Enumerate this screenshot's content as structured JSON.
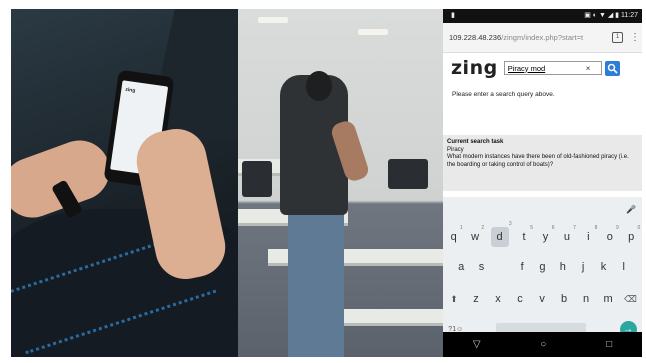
{
  "status_bar": {
    "time": "11:27",
    "icons": "▣ ◐ ▼ ◢ ▮"
  },
  "browser": {
    "url_host": "109.228.48.236",
    "url_path": "/zingm/index.php?start=t",
    "tabs_count": "1",
    "menu_glyph": "⋮"
  },
  "app": {
    "logo": "zing",
    "search_value": "Piracy mod",
    "clear_glyph": "×"
  },
  "prompt_text": "Please enter a search query above.",
  "task": {
    "title": "Current search task",
    "topic": "Piracy",
    "question": "What modern instances have there been of old-fashioned piracy (i.e. the boarding or taking control of boats)?"
  },
  "keyboard": {
    "row1": [
      {
        "k": "q",
        "n": "1"
      },
      {
        "k": "w",
        "n": "2"
      },
      {
        "k": "d",
        "n": "3"
      },
      {
        "k": "t",
        "n": "5"
      },
      {
        "k": "y",
        "n": "6"
      },
      {
        "k": "u",
        "n": "7"
      },
      {
        "k": "i",
        "n": "8"
      },
      {
        "k": "o",
        "n": "9"
      },
      {
        "k": "p",
        "n": "0"
      }
    ],
    "row2": [
      "a",
      "s",
      "",
      "f",
      "g",
      "h",
      "j",
      "k",
      "l"
    ],
    "row3": [
      "z",
      "x",
      "c",
      "v",
      "b",
      "n",
      "m"
    ],
    "shift": "⬆",
    "backspace": "⌫",
    "sym": "?1☺",
    "comma": ",",
    "period": ".",
    "enter": "→",
    "mic": "🎤"
  },
  "navbar": {
    "back": "▽",
    "home": "○",
    "recent": "□"
  },
  "photo1": {
    "phone_text": "zing"
  }
}
